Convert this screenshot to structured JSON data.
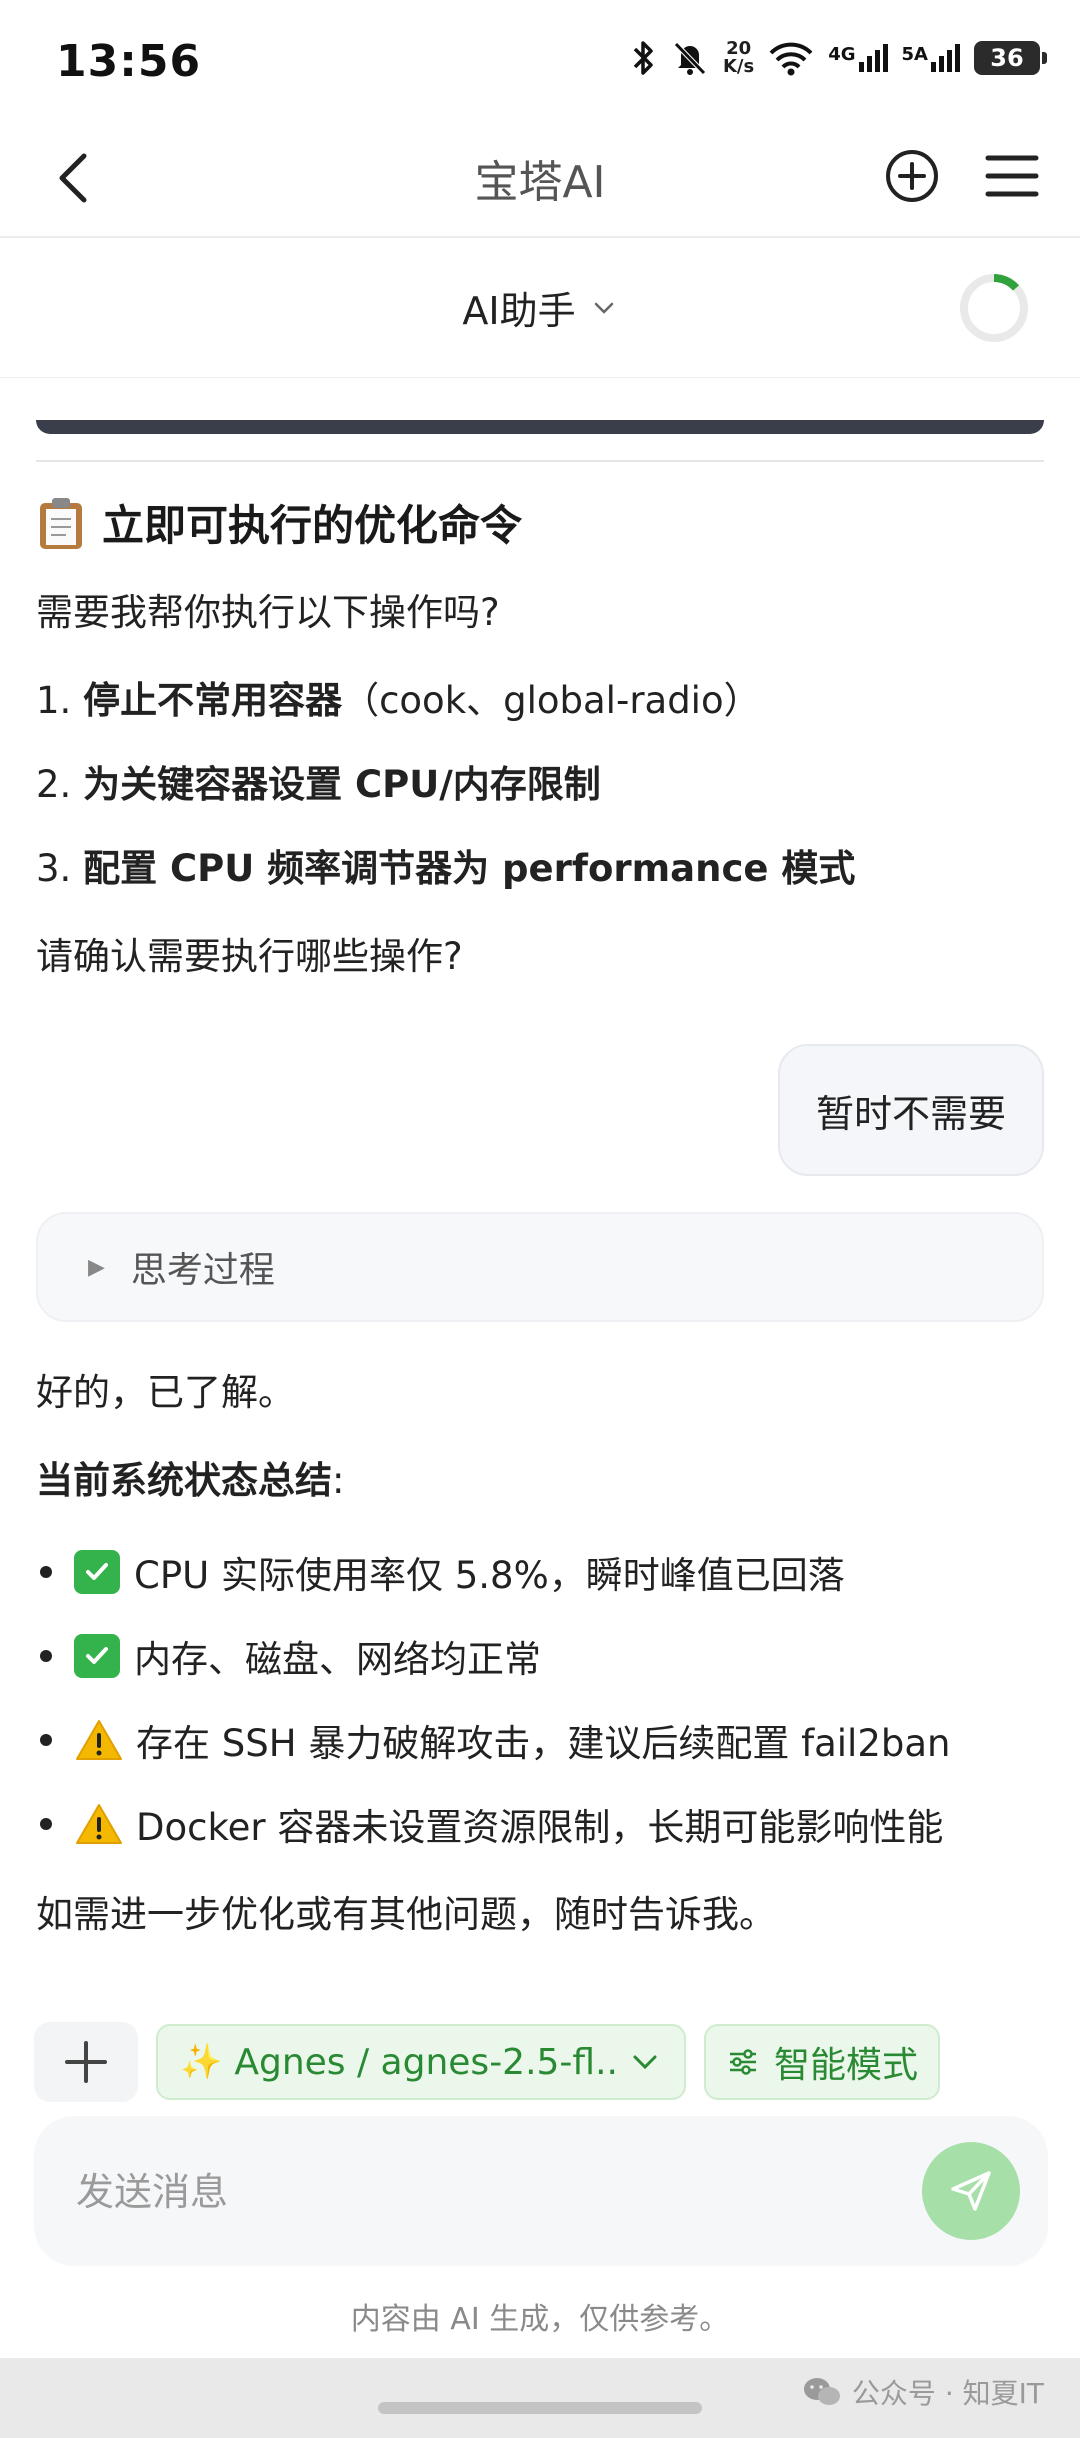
{
  "status_bar": {
    "time": "13:56",
    "net_speed_value": "20",
    "net_speed_unit": "K/s",
    "signal_1": "4G",
    "signal_2": "5A",
    "battery": "36"
  },
  "nav": {
    "title": "宝塔AI"
  },
  "assistant": {
    "selector_label": "AI助手"
  },
  "chat": {
    "section_title": "立即可执行的优化命令",
    "question": "需要我帮你执行以下操作吗?",
    "steps": [
      {
        "num": "1.",
        "bold": "停止不常用容器",
        "rest": "（cook、global-radio）"
      },
      {
        "num": "2.",
        "bold": "为关键容器设置 CPU/内存限制",
        "rest": ""
      },
      {
        "num": "3.",
        "bold": "配置 CPU 频率调节器为 performance 模式",
        "rest": ""
      }
    ],
    "confirm": "请确认需要执行哪些操作?",
    "user_reply": "暂时不需要",
    "thinking_label": "思考过程",
    "ack": "好的，已了解。",
    "summary_title": "当前系统状态总结",
    "summary_colon": ":",
    "summary_items": [
      {
        "icon": "check-icon",
        "text": "CPU 实际使用率仅 5.8%，瞬时峰值已回落"
      },
      {
        "icon": "check-icon",
        "text": "内存、磁盘、网络均正常"
      },
      {
        "icon": "warning-icon",
        "text": "存在 SSH 暴力破解攻击，建议后续配置 fail2ban"
      },
      {
        "icon": "warning-icon",
        "text": "Docker 容器未设置资源限制，长期可能影响性能"
      }
    ],
    "closing": "如需进一步优化或有其他问题，随时告诉我。"
  },
  "composer": {
    "model_label": "Agnes / agnes-2.5-fl...",
    "mode_label": "智能模式",
    "input_placeholder": "发送消息",
    "input_value": "",
    "disclaimer": "内容由 AI 生成，仅供参考。"
  },
  "footer": {
    "watermark": "公众号 · 知夏IT"
  },
  "colors": {
    "accent_green": "#34b24b",
    "chip_text_green": "#2a8a34",
    "send_button": "#a6dfa8"
  }
}
